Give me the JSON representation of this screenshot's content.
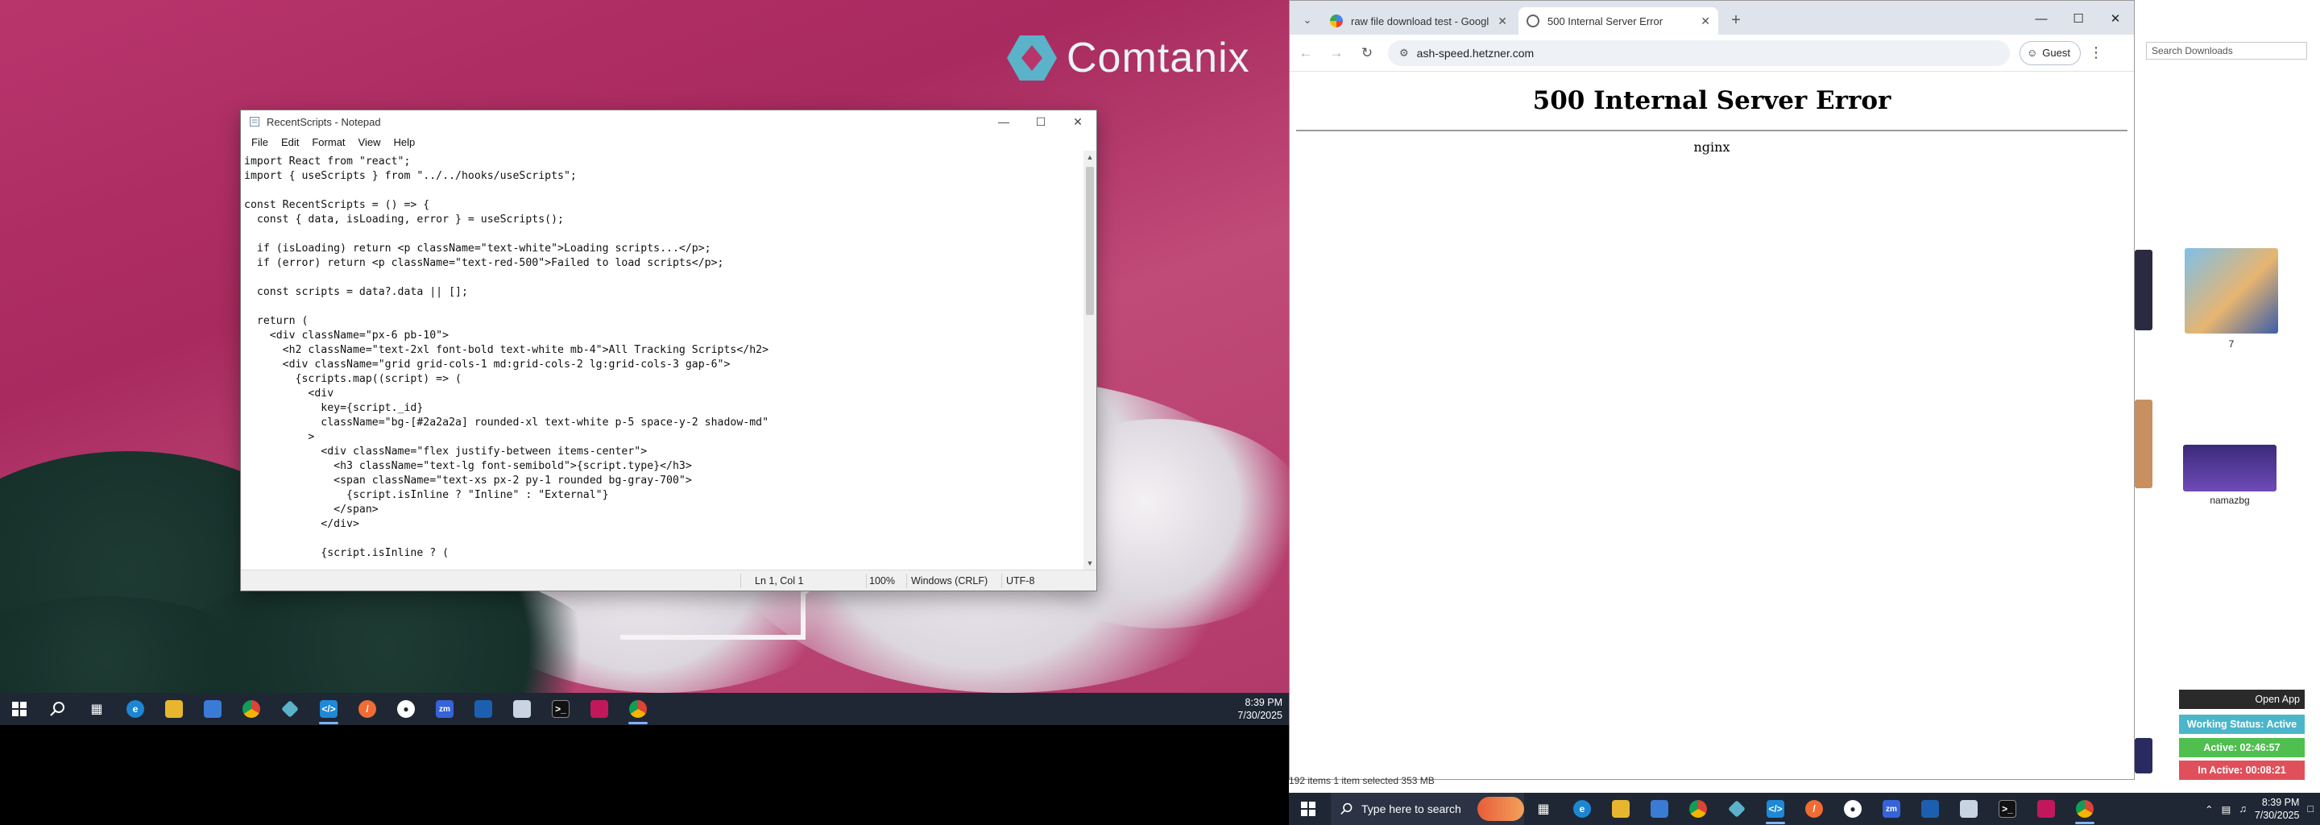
{
  "left": {
    "logo_text": "Comtanix",
    "notepad": {
      "title": "RecentScripts - Notepad",
      "menus": [
        "File",
        "Edit",
        "Format",
        "View",
        "Help"
      ],
      "code": "import React from \"react\";\nimport { useScripts } from \"../../hooks/useScripts\";\n\nconst RecentScripts = () => {\n  const { data, isLoading, error } = useScripts();\n\n  if (isLoading) return <p className=\"text-white\">Loading scripts...</p>;\n  if (error) return <p className=\"text-red-500\">Failed to load scripts</p>;\n\n  const scripts = data?.data || [];\n\n  return (\n    <div className=\"px-6 pb-10\">\n      <h2 className=\"text-2xl font-bold text-white mb-4\">All Tracking Scripts</h2>\n      <div className=\"grid grid-cols-1 md:grid-cols-2 lg:grid-cols-3 gap-6\">\n        {scripts.map((script) => (\n          <div\n            key={script._id}\n            className=\"bg-[#2a2a2a] rounded-xl text-white p-5 space-y-2 shadow-md\"\n          >\n            <div className=\"flex justify-between items-center\">\n              <h3 className=\"text-lg font-semibold\">{script.type}</h3>\n              <span className=\"text-xs px-2 py-1 rounded bg-gray-700\">\n                {script.isInline ? \"Inline\" : \"External\"}\n              </span>\n            </div>\n\n            {script.isInline ? (",
      "status": {
        "position": "Ln 1, Col 1",
        "zoom": "100%",
        "line_ending": "Windows (CRLF)",
        "encoding": "UTF-8"
      }
    },
    "taskbar": {
      "time": "8:39 PM",
      "date": "7/30/2025"
    }
  },
  "right": {
    "explorer": {
      "search_placeholder": "Search Downloads",
      "thumb_labels": [
        "7",
        "namazbg"
      ],
      "status": "192 items    1 item selected  353 MB"
    },
    "chrome": {
      "tabs": [
        {
          "label": "raw file download test - Googl",
          "active": false
        },
        {
          "label": "500 Internal Server Error",
          "active": true
        }
      ],
      "url": "ash-speed.hetzner.com",
      "profile": "Guest"
    },
    "page": {
      "heading": "500 Internal Server Error",
      "server": "nginx"
    },
    "widgets": {
      "open_app": "Open App",
      "working_status": "Working Status: Active",
      "active": "Active: 02:46:57",
      "inactive": "In Active: 00:08:21"
    },
    "taskbar": {
      "search_placeholder": "Type here to search",
      "time": "8:39 PM",
      "date": "7/30/2025"
    }
  }
}
